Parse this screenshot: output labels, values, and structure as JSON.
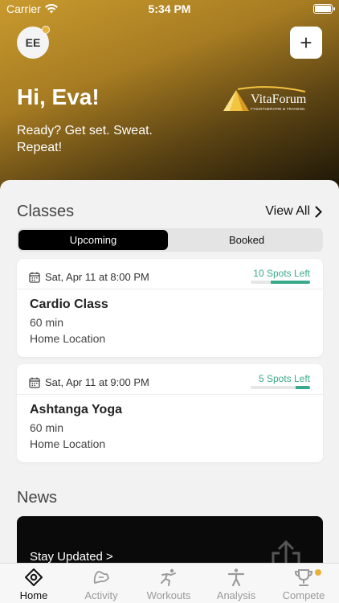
{
  "status_bar": {
    "carrier": "Carrier",
    "time": "5:34 PM"
  },
  "header": {
    "avatar_initials": "EE",
    "greeting": "Hi, Eva!",
    "subtext": "Ready? Get set. Sweat. Repeat!",
    "add_label": "+",
    "logo_brand": "VitaForum",
    "logo_tagline": "FYSIOTHERAPIE & TRAINING"
  },
  "classes": {
    "title": "Classes",
    "view_all": "View All",
    "tabs": [
      {
        "label": "Upcoming",
        "active": true
      },
      {
        "label": "Booked",
        "active": false
      }
    ],
    "items": [
      {
        "date": "Sat, Apr 11 at 8:00 PM",
        "spots": "10 Spots Left",
        "fill": 0.66,
        "name": "Cardio Class",
        "duration": "60 min",
        "location": "Home Location"
      },
      {
        "date": "Sat, Apr 11 at 9:00 PM",
        "spots": "5 Spots Left",
        "fill": 0.25,
        "name": "Ashtanga Yoga",
        "duration": "60 min",
        "location": "Home Location"
      }
    ]
  },
  "news": {
    "title": "News",
    "cta": "Stay Updated >"
  },
  "tabbar": {
    "items": [
      {
        "label": "Home",
        "icon": "home-icon",
        "active": true
      },
      {
        "label": "Activity",
        "icon": "activity-icon",
        "active": false
      },
      {
        "label": "Workouts",
        "icon": "workouts-icon",
        "active": false
      },
      {
        "label": "Analysis",
        "icon": "analysis-icon",
        "active": false
      },
      {
        "label": "Compete",
        "icon": "trophy-icon",
        "active": false
      }
    ]
  },
  "colors": {
    "accent": "#3aaa8c",
    "gold": "#c99a2e",
    "badge": "#e8b23a"
  }
}
